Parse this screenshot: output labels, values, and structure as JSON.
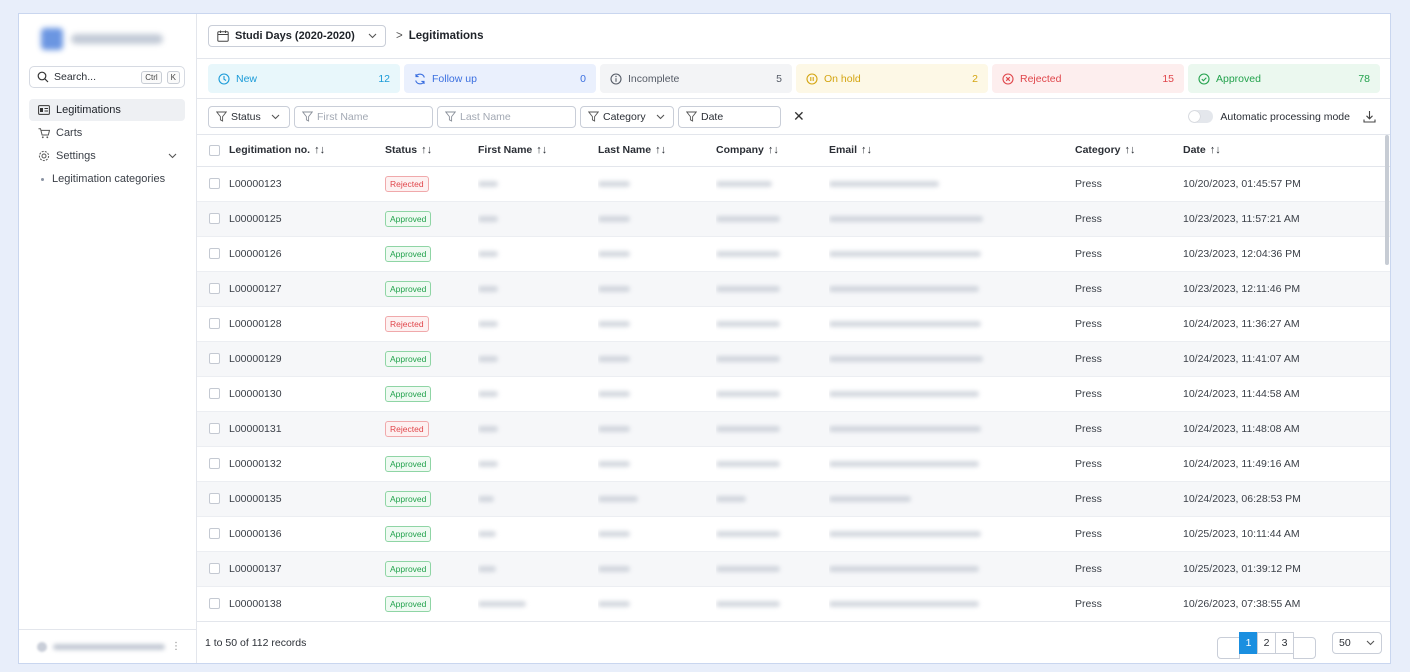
{
  "sidebar": {
    "search_label": "Search...",
    "shortcut_ctrl": "Ctrl",
    "shortcut_key": "K",
    "items": [
      {
        "label": "Legitimations",
        "icon": "id-card-icon"
      },
      {
        "label": "Carts",
        "icon": "cart-icon"
      },
      {
        "label": "Settings",
        "icon": "gear-icon"
      }
    ],
    "sub_items": [
      {
        "label": "Legitimation categories"
      }
    ]
  },
  "header": {
    "event": "Studi Days (2020-2020)",
    "breadcrumb_sep": ">",
    "breadcrumb": "Legitimations"
  },
  "status_tiles": [
    {
      "label": "New",
      "count": "12",
      "color": "#1a9bd8",
      "bg": "#e8f7fb"
    },
    {
      "label": "Follow up",
      "count": "0",
      "color": "#3b6fe0",
      "bg": "#eaf0fd"
    },
    {
      "label": "Incomplete",
      "count": "5",
      "color": "#555b66",
      "bg": "#f3f4f6"
    },
    {
      "label": "On hold",
      "count": "2",
      "color": "#d4a512",
      "bg": "#fdf8e6"
    },
    {
      "label": "Rejected",
      "count": "15",
      "color": "#e0464b",
      "bg": "#fdeeee"
    },
    {
      "label": "Approved",
      "count": "78",
      "color": "#23a24d",
      "bg": "#ebf8ef"
    }
  ],
  "filters": {
    "status": "Status",
    "first_name": "First Name",
    "last_name": "Last Name",
    "category": "Category",
    "date": "Date",
    "clear": "✕",
    "auto_mode": "Automatic processing mode"
  },
  "table": {
    "columns": [
      "Legitimation no.",
      "Status",
      "First Name",
      "Last Name",
      "Company",
      "Email",
      "Category",
      "Date"
    ],
    "rows": [
      {
        "no": "L00000123",
        "status": "Rejected",
        "category": "Press",
        "date": "10/20/2023, 01:45:57 PM"
      },
      {
        "no": "L00000125",
        "status": "Approved",
        "category": "Press",
        "date": "10/23/2023, 11:57:21 AM"
      },
      {
        "no": "L00000126",
        "status": "Approved",
        "category": "Press",
        "date": "10/23/2023, 12:04:36 PM"
      },
      {
        "no": "L00000127",
        "status": "Approved",
        "category": "Press",
        "date": "10/23/2023, 12:11:46 PM"
      },
      {
        "no": "L00000128",
        "status": "Rejected",
        "category": "Press",
        "date": "10/24/2023, 11:36:27 AM"
      },
      {
        "no": "L00000129",
        "status": "Approved",
        "category": "Press",
        "date": "10/24/2023, 11:41:07 AM"
      },
      {
        "no": "L00000130",
        "status": "Approved",
        "category": "Press",
        "date": "10/24/2023, 11:44:58 AM"
      },
      {
        "no": "L00000131",
        "status": "Rejected",
        "category": "Press",
        "date": "10/24/2023, 11:48:08 AM"
      },
      {
        "no": "L00000132",
        "status": "Approved",
        "category": "Press",
        "date": "10/24/2023, 11:49:16 AM"
      },
      {
        "no": "L00000135",
        "status": "Approved",
        "category": "Press",
        "date": "10/24/2023, 06:28:53 PM"
      },
      {
        "no": "L00000136",
        "status": "Approved",
        "category": "Press",
        "date": "10/25/2023, 10:11:44 AM"
      },
      {
        "no": "L00000137",
        "status": "Approved",
        "category": "Press",
        "date": "10/25/2023, 01:39:12 PM"
      },
      {
        "no": "L00000138",
        "status": "Approved",
        "category": "Press",
        "date": "10/26/2023, 07:38:55 AM"
      }
    ]
  },
  "footer": {
    "records": "1 to 50 of 112 records",
    "pages": [
      "1",
      "2",
      "3"
    ],
    "current_page": "1",
    "per_page": "50"
  }
}
